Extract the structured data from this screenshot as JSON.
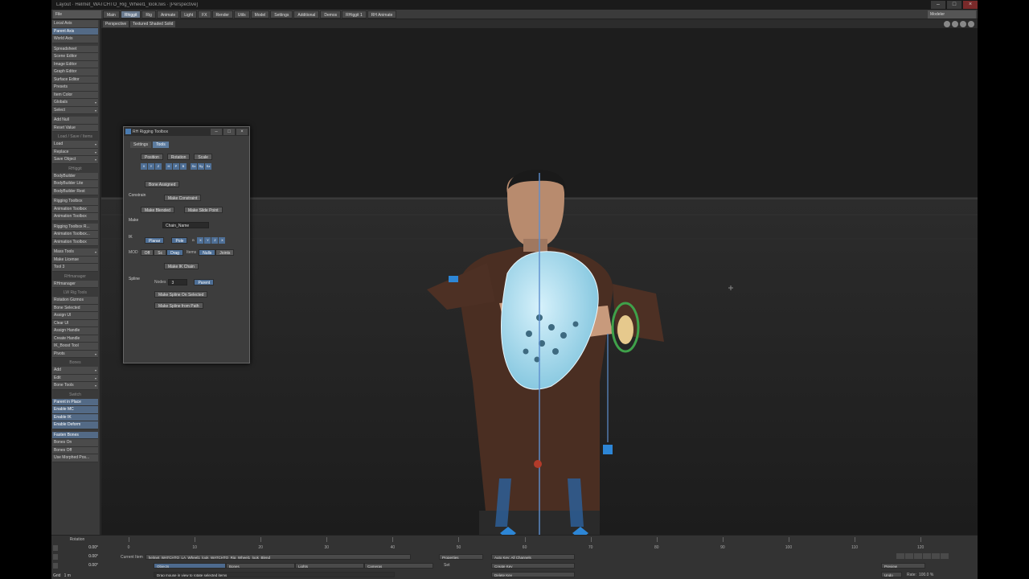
{
  "window": {
    "title": "Layout · Helmet_WATCHTO_Rig_Wheel1_look.lws · [Perspective]"
  },
  "tabs": [
    "Main",
    "Rhiggit",
    "Rig",
    "Animate",
    "Light",
    "FX",
    "Render",
    "Utils",
    "Model",
    "Settings",
    "Additional",
    "Demos",
    "RHiggit 1",
    "RH Animate"
  ],
  "active_tab": "Rhiggit",
  "file_menu": "File",
  "modeler_button": "Modeler",
  "toolbar": {
    "group1": [
      "Local Axis",
      "Parent Axis",
      "World Axis"
    ],
    "group2": [
      "Spreadsheet",
      "Scene Editor",
      "Image Editor",
      "Graph Editor",
      "Surface Editor",
      "Presets",
      "Item Color",
      "Globals",
      "Select"
    ],
    "group3": [
      "Add Null",
      "Reset Value"
    ],
    "header_loadsave": "Load / Save / Items",
    "group4": [
      "Load",
      "Replace",
      "Save Object"
    ],
    "header_rhiggit": "RHiggit",
    "group5": [
      "BodyBuilder",
      "BodyBuilder Lite",
      "BodyBuilder Rest"
    ],
    "group6": [
      "Rigging Toolbox",
      "Animation Toolbox",
      "Animation Toolbox"
    ],
    "group7": [
      "Rigging Toolbox R...",
      "Animation Toolbox...",
      "Animation Toolbox"
    ],
    "group8": [
      "Mass Tools",
      "Make License",
      "Tool 3"
    ],
    "header_rhmanager": "RHmanager",
    "group9": [
      "RHmanager"
    ],
    "header_lw": "LW Rig Tools",
    "group10": [
      "Rotation Gizmos",
      "Bone Selected",
      "Assign UI",
      "Clear UI",
      "Assign Handle",
      "Create Handle",
      "IK_Boost Tool",
      "Pivots"
    ],
    "header_bones": "Bones",
    "group11": [
      "Add",
      "Edit",
      "Bone Tools"
    ],
    "header_switch": "Switch",
    "group12": [
      "Parent in Place",
      "Enable MC",
      "Enable IK",
      "Enable Deform"
    ],
    "group13": [
      "Fasten Bones",
      "Bones On",
      "Bones Off",
      "Use Morphed Pos..."
    ]
  },
  "toolbar_active": [
    "Parent Axis",
    "Parent in Place",
    "Enable MC",
    "Enable IK",
    "Enable Deform",
    "Fasten Bones"
  ],
  "viewport": {
    "view_mode": "Perspective",
    "shading_mode": "Textured Shaded Solid"
  },
  "panel": {
    "title": "RH Rigging Toolbox",
    "tabs": [
      "Settings",
      "Tools"
    ],
    "active_tab": "Tools",
    "row1": [
      "Position",
      "Rotation",
      "Scale"
    ],
    "axes": [
      "X",
      "Y",
      "Z",
      "H",
      "P",
      "B",
      "Sx",
      "Sy",
      "Sz"
    ],
    "bone_assigned": "Bone Assigned",
    "constrain_label": "Constrain",
    "make_constraint": "Make Constraint",
    "make_blended": "Make Blended",
    "make_slide_point": "Make Slide Point",
    "make_label": "Make",
    "chain_name": "Chain_Name",
    "ik_label": "IK",
    "planar": "Planar",
    "pole": "Pole",
    "ik_axes": [
      "B",
      "X",
      "Y",
      "Z",
      "X"
    ],
    "mod_label": "MOD",
    "mod_off": "Off",
    "mod_sc": "Sc",
    "mod_drag": "Drag",
    "items_label": "Items",
    "nulls": "Nulls",
    "joints": "Joints",
    "make_ik_chain": "Make IK Chain",
    "spline_label": "Spline",
    "nodes_label": "Nodes",
    "nodes_value": "3",
    "parent": "Parent",
    "make_spline_selected": "Make Spline On Selected",
    "make_spline_path": "Make Spline from Path"
  },
  "bottom": {
    "rotation_label": "Rotation",
    "rot_values": [
      "0.00°",
      "0.00°",
      "0.00°"
    ],
    "grid_label": "Grid",
    "grid_value": "1 m",
    "ruler_ticks": [
      "0",
      "10",
      "20",
      "30",
      "40",
      "50",
      "60",
      "70",
      "80",
      "90",
      "100",
      "110",
      "120"
    ],
    "current_item_label": "Current Item",
    "current_item": "helmet_WATCHTO_LA_Wheel1_look_WATCHTO_Rig_Wheel1_look_Blend",
    "property_label": "Properties",
    "set_label": "Set",
    "autokey": "Auto Key: All Channels",
    "objects": "Objects",
    "bones": "Bones",
    "lights": "Lights",
    "cameras": "Cameras",
    "create_key": "Create Key",
    "delete_key": "Delete Key",
    "status": "Drag mouse in view to rotate selected items",
    "preview": "Preview",
    "undo": "Undo",
    "rate": "Rate:",
    "rate_value": "100.0 %"
  }
}
